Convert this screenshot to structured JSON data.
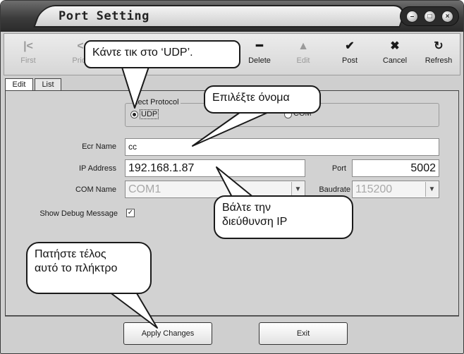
{
  "window": {
    "title": "Port Setting",
    "controls": [
      "minimize-icon",
      "restore-icon",
      "close-icon"
    ]
  },
  "toolbar": {
    "buttons": [
      {
        "label": "First",
        "icon": "first-icon",
        "enabled": false
      },
      {
        "label": "Prior",
        "icon": "prior-icon",
        "enabled": false
      },
      {
        "label": "Delete",
        "icon": "delete-icon",
        "enabled": true
      },
      {
        "label": "Edit",
        "icon": "edit-icon",
        "enabled": false
      },
      {
        "label": "Post",
        "icon": "post-icon",
        "enabled": true
      },
      {
        "label": "Cancel",
        "icon": "cancel-icon",
        "enabled": true
      },
      {
        "label": "Refresh",
        "icon": "refresh-icon",
        "enabled": true
      }
    ]
  },
  "tabs": [
    {
      "label": "Edit",
      "active": true
    },
    {
      "label": "List",
      "active": false
    }
  ],
  "protocol": {
    "legend": "Select Protocol",
    "legend_visible": "lect Protocol",
    "options": [
      {
        "label": "UDP",
        "selected": true
      },
      {
        "label": "COM",
        "selected": false
      }
    ]
  },
  "form": {
    "ecr_name": {
      "label": "Ecr Name",
      "value": "cc"
    },
    "ip_address": {
      "label": "IP Address",
      "value": "192.168.1.87"
    },
    "port": {
      "label": "Port",
      "value": "5002"
    },
    "com_name": {
      "label": "COM Name",
      "value": "COM1"
    },
    "baudrate": {
      "label": "Baudrate",
      "value": "115200"
    },
    "show_debug": {
      "label": "Show Debug Message",
      "checked": true
    }
  },
  "footer": {
    "apply_label": "Apply Changes",
    "exit_label": "Exit"
  },
  "callouts": {
    "udp_tip": "Κάντε τικ στο ‘UDP’.",
    "name_tip": "Επιλέξτε όνομα",
    "ip_tip_line1": "Βάλτε την",
    "ip_tip_line2": "διεύθυνση IP",
    "apply_tip_line1": "Πατήστε τέλος",
    "apply_tip_line2": "αυτό το πλήκτρο"
  },
  "colors": {
    "window_bg": "#cfcfcf",
    "titlebar_dark": "#2a2a2a",
    "panel_bg": "#d2d2d2",
    "disabled_text": "#a8a8a8"
  }
}
